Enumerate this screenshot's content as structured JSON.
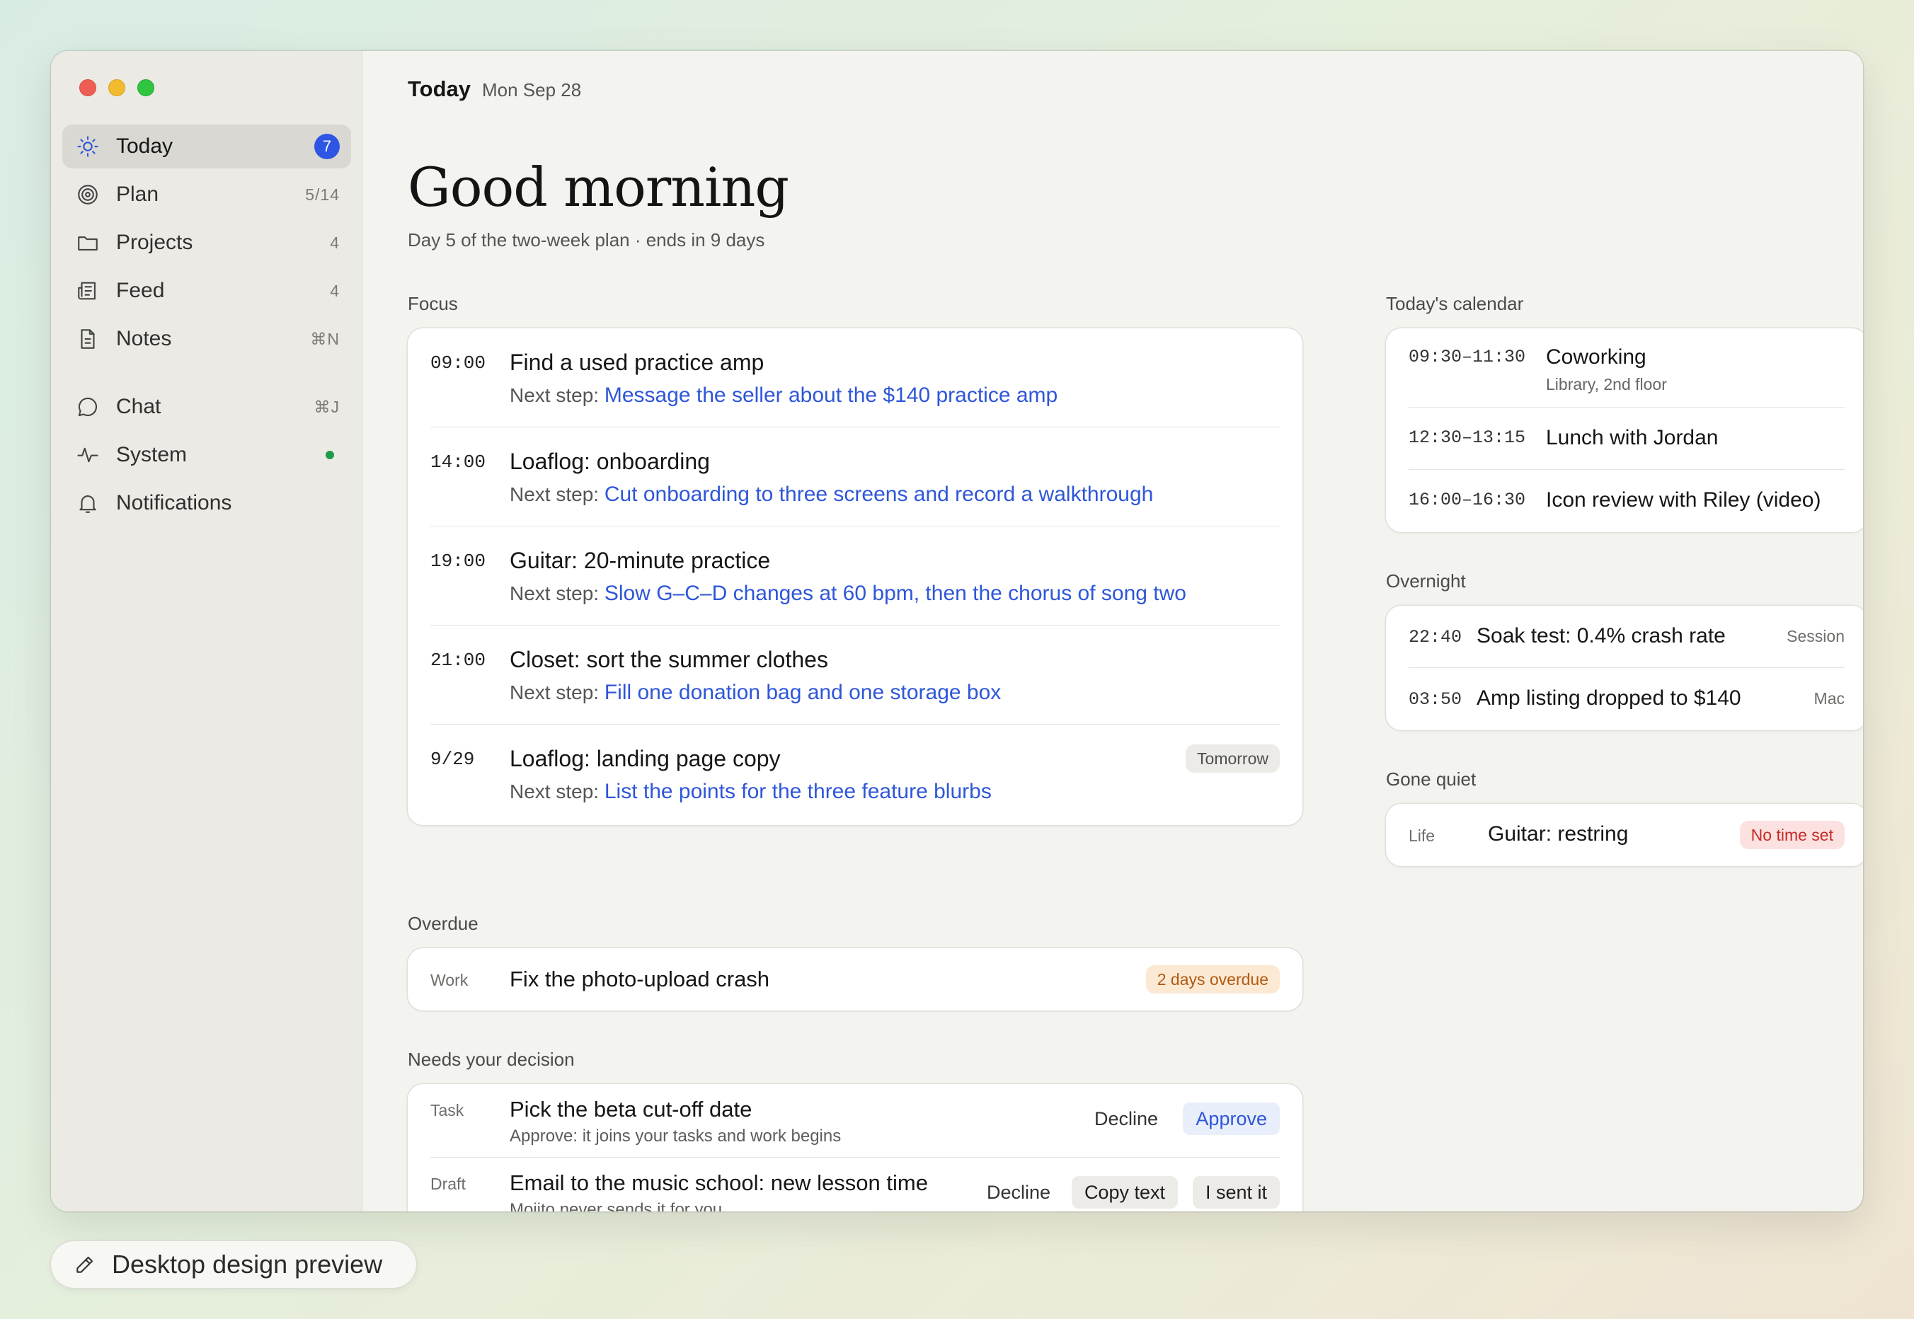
{
  "header": {
    "title": "Today",
    "date": "Mon Sep 28"
  },
  "greeting": "Good morning",
  "subline": "Day 5 of the two-week plan · ends in 9 days",
  "sidebar": {
    "items": [
      {
        "label": "Today",
        "badge": "7",
        "icon": "sun-icon"
      },
      {
        "label": "Plan",
        "count": "5/14",
        "icon": "target-icon"
      },
      {
        "label": "Projects",
        "count": "4",
        "icon": "folder-icon"
      },
      {
        "label": "Feed",
        "count": "4",
        "icon": "newspaper-icon"
      },
      {
        "label": "Notes",
        "count": "⌘N",
        "icon": "document-icon"
      },
      {
        "label": "Chat",
        "count": "⌘J",
        "icon": "chat-bubble-icon"
      },
      {
        "label": "System",
        "status_color": "#1f9a48",
        "icon": "pulse-icon"
      },
      {
        "label": "Notifications",
        "icon": "bell-icon"
      }
    ]
  },
  "focus": {
    "label": "Focus",
    "next_step_prefix": "Next step:",
    "items": [
      {
        "time": "09:00",
        "title": "Find a used practice amp",
        "next": "Message the seller about the $140 practice amp"
      },
      {
        "time": "14:00",
        "title": "Loaflog: onboarding",
        "next": "Cut onboarding to three screens and record a walkthrough"
      },
      {
        "time": "19:00",
        "title": "Guitar: 20-minute practice",
        "next": "Slow G–C–D changes at 60 bpm, then the chorus of song two"
      },
      {
        "time": "21:00",
        "title": "Closet: sort the summer clothes",
        "next": "Fill one donation bag and one storage box"
      },
      {
        "time": "9/29",
        "title": "Loaflog: landing page copy",
        "next": "List the points for the three feature blurbs",
        "pill": "Tomorrow"
      }
    ]
  },
  "overdue": {
    "label": "Overdue",
    "tag": "Work",
    "title": "Fix the photo-upload crash",
    "pill": "2 days overdue"
  },
  "decision": {
    "label": "Needs your decision",
    "items": [
      {
        "tag": "Task",
        "title": "Pick the beta cut-off date",
        "sub": "Approve: it joins your tasks and work begins",
        "decline": "Decline",
        "approve": "Approve"
      },
      {
        "tag": "Draft",
        "title": "Email to the music school: new lesson time",
        "sub": "Mojito never sends it for you",
        "decline": "Decline",
        "copy": "Copy text",
        "sent": "I sent it"
      }
    ]
  },
  "calendar": {
    "label": "Today's calendar",
    "items": [
      {
        "time": "09:30–11:30",
        "title": "Coworking",
        "sub": "Library, 2nd floor"
      },
      {
        "time": "12:30–13:15",
        "title": "Lunch with Jordan"
      },
      {
        "time": "16:00–16:30",
        "title": "Icon review with Riley (video)"
      }
    ]
  },
  "overnight": {
    "label": "Overnight",
    "items": [
      {
        "time": "22:40",
        "title": "Soak test: 0.4% crash rate",
        "source": "Session"
      },
      {
        "time": "03:50",
        "title": "Amp listing dropped to $140",
        "source": "Mac"
      }
    ]
  },
  "gone_quiet": {
    "label": "Gone quiet",
    "tag": "Life",
    "title": "Guitar: restring",
    "pill": "No time set"
  },
  "preview_pill": {
    "label": "Desktop design preview",
    "icon": "pencil-icon"
  },
  "colors": {
    "accent": "#2e56d8",
    "badge": "#2f55e4",
    "overdue": "#b05a12",
    "alert": "#c42b27"
  }
}
